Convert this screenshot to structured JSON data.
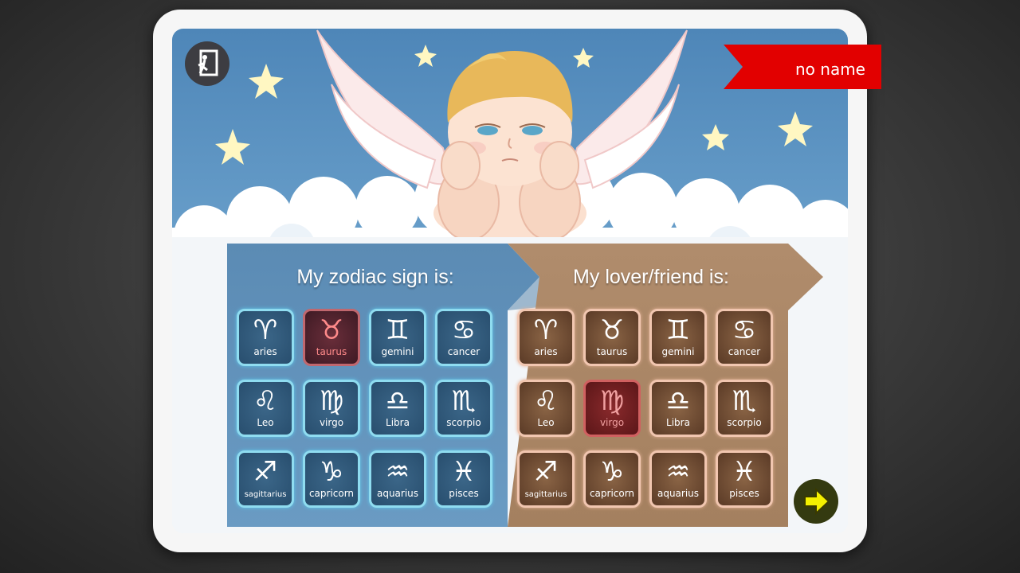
{
  "player": {
    "name": "no name"
  },
  "colors": {
    "sky": "#5b92c2",
    "ribbon": "#e20000",
    "mine_panel": "#5f91b9",
    "lover_panel": "#a88668",
    "selected_tile": "#6b2430",
    "next_arrow": "#f4f000"
  },
  "icons": {
    "exit": "exit-door-icon",
    "next": "arrow-right-icon"
  },
  "mine": {
    "title": "My zodiac sign is:",
    "selected": "taurus",
    "signs": [
      {
        "key": "aries",
        "label": "aries",
        "glyph": "♈"
      },
      {
        "key": "taurus",
        "label": "taurus",
        "glyph": "♉"
      },
      {
        "key": "gemini",
        "label": "gemini",
        "glyph": "♊"
      },
      {
        "key": "cancer",
        "label": "cancer",
        "glyph": "♋"
      },
      {
        "key": "leo",
        "label": "Leo",
        "glyph": "♌"
      },
      {
        "key": "virgo",
        "label": "virgo",
        "glyph": "♍"
      },
      {
        "key": "libra",
        "label": "Libra",
        "glyph": "♎"
      },
      {
        "key": "scorpio",
        "label": "scorpio",
        "glyph": "♏"
      },
      {
        "key": "sagittarius",
        "label": "sagittarius",
        "glyph": "♐"
      },
      {
        "key": "capricorn",
        "label": "capricorn",
        "glyph": "♑"
      },
      {
        "key": "aquarius",
        "label": "aquarius",
        "glyph": "♒"
      },
      {
        "key": "pisces",
        "label": "pisces",
        "glyph": "♓"
      }
    ]
  },
  "lover": {
    "title": "My lover/friend is:",
    "selected": "virgo",
    "signs": [
      {
        "key": "aries",
        "label": "aries",
        "glyph": "♈"
      },
      {
        "key": "taurus",
        "label": "taurus",
        "glyph": "♉"
      },
      {
        "key": "gemini",
        "label": "gemini",
        "glyph": "♊"
      },
      {
        "key": "cancer",
        "label": "cancer",
        "glyph": "♋"
      },
      {
        "key": "leo",
        "label": "Leo",
        "glyph": "♌"
      },
      {
        "key": "virgo",
        "label": "virgo",
        "glyph": "♍"
      },
      {
        "key": "libra",
        "label": "Libra",
        "glyph": "♎"
      },
      {
        "key": "scorpio",
        "label": "scorpio",
        "glyph": "♏"
      },
      {
        "key": "sagittarius",
        "label": "sagittarius",
        "glyph": "♐"
      },
      {
        "key": "capricorn",
        "label": "capricorn",
        "glyph": "♑"
      },
      {
        "key": "aquarius",
        "label": "aquarius",
        "glyph": "♒"
      },
      {
        "key": "pisces",
        "label": "pisces",
        "glyph": "♓"
      }
    ]
  }
}
